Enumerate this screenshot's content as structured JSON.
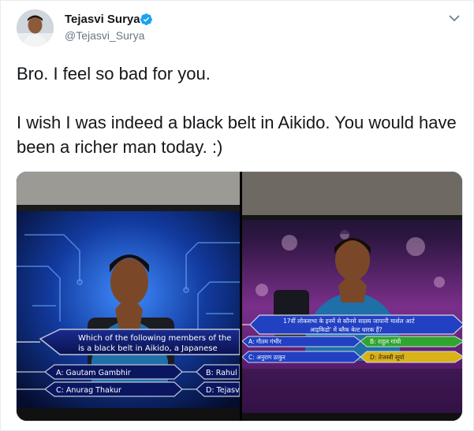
{
  "author": {
    "name": "Tejasvi Surya",
    "handle": "@Tejasvi_Surya",
    "verified": true
  },
  "tweet": {
    "line1": "Bro. I feel so bad for you.",
    "line2": "I wish I was indeed a black belt in Aikido. You would have been a richer man today. :)"
  },
  "media": {
    "left_photo": {
      "question_line1": "Which of the following members of the",
      "question_line2": "is a black belt in Aikido, a Japanese",
      "option_a": "A: Gautam Gambhir",
      "option_b": "B: Rahul (",
      "option_c": "C: Anurag Thakur",
      "option_d": "D: Tejasv"
    },
    "right_photo": {
      "question_line1": "17वीं लोकसभा के इनमें से कौनसे सदस्य जापानी मार्शल आर्ट",
      "question_line2": "आइकिडो' में ब्लैक बेल्ट धारक हैं?",
      "option_a": "A: गौतम गंभीर",
      "option_b": "B: राहुल गांधी",
      "option_c": "C: अनुराग ठाकुर",
      "option_d": "D: तेजस्वी सूर्या"
    }
  },
  "colors": {
    "verified_blue": "#1da1f2",
    "handle_gray": "#657786",
    "kbc_blue": "#1b3fb8",
    "kbc_purple": "#5b1fa0",
    "option_green": "#2fa52f",
    "option_yellow": "#d9b11a"
  },
  "icons": [
    "verified-badge-icon",
    "chevron-down-icon"
  ]
}
